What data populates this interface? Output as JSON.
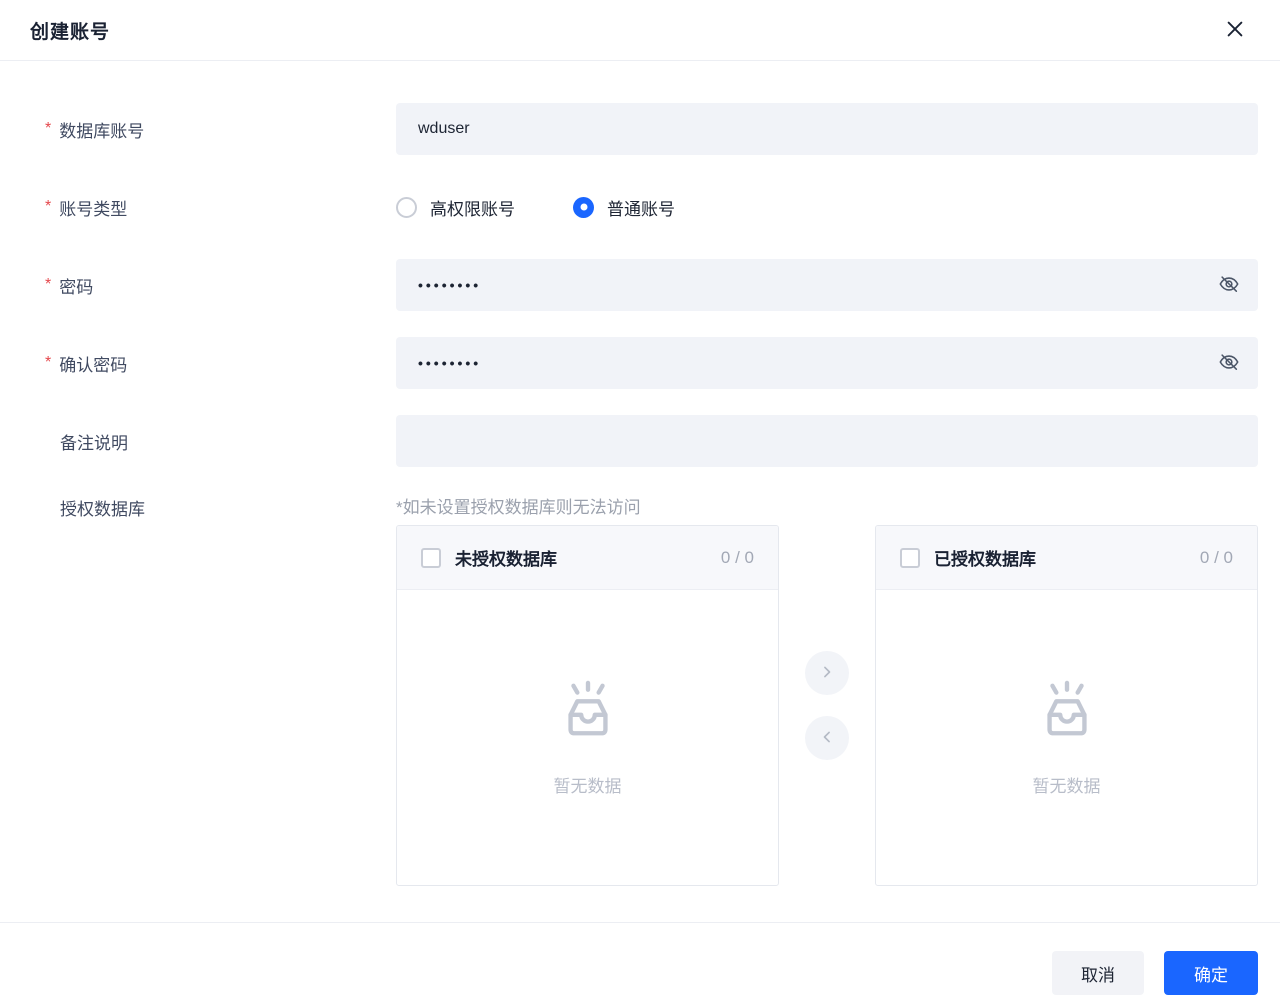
{
  "dialog": {
    "title": "创建账号"
  },
  "form": {
    "fields": {
      "account": {
        "label": "数据库账号",
        "required": true,
        "value": "wduser"
      },
      "account_type": {
        "label": "账号类型",
        "required": true,
        "options": [
          {
            "label": "高权限账号",
            "selected": false
          },
          {
            "label": "普通账号",
            "selected": true
          }
        ]
      },
      "password": {
        "label": "密码",
        "required": true,
        "value": "••••••••",
        "masked": true
      },
      "confirm_password": {
        "label": "确认密码",
        "required": true,
        "value": "••••••••",
        "masked": true
      },
      "remark": {
        "label": "备注说明",
        "required": false,
        "value": ""
      },
      "authorized_db": {
        "label": "授权数据库",
        "required": false,
        "note": "*如未设置授权数据库则无法访问"
      }
    }
  },
  "transfer": {
    "source": {
      "title": "未授权数据库",
      "count": "0 / 0",
      "empty_text": "暂无数据"
    },
    "target": {
      "title": "已授权数据库",
      "count": "0 / 0",
      "empty_text": "暂无数据"
    }
  },
  "footer": {
    "cancel_label": "取消",
    "confirm_label": "确定"
  },
  "colors": {
    "accent": "#1a66ff",
    "required_star": "#e5484d",
    "input_bg": "#f1f3f8"
  }
}
